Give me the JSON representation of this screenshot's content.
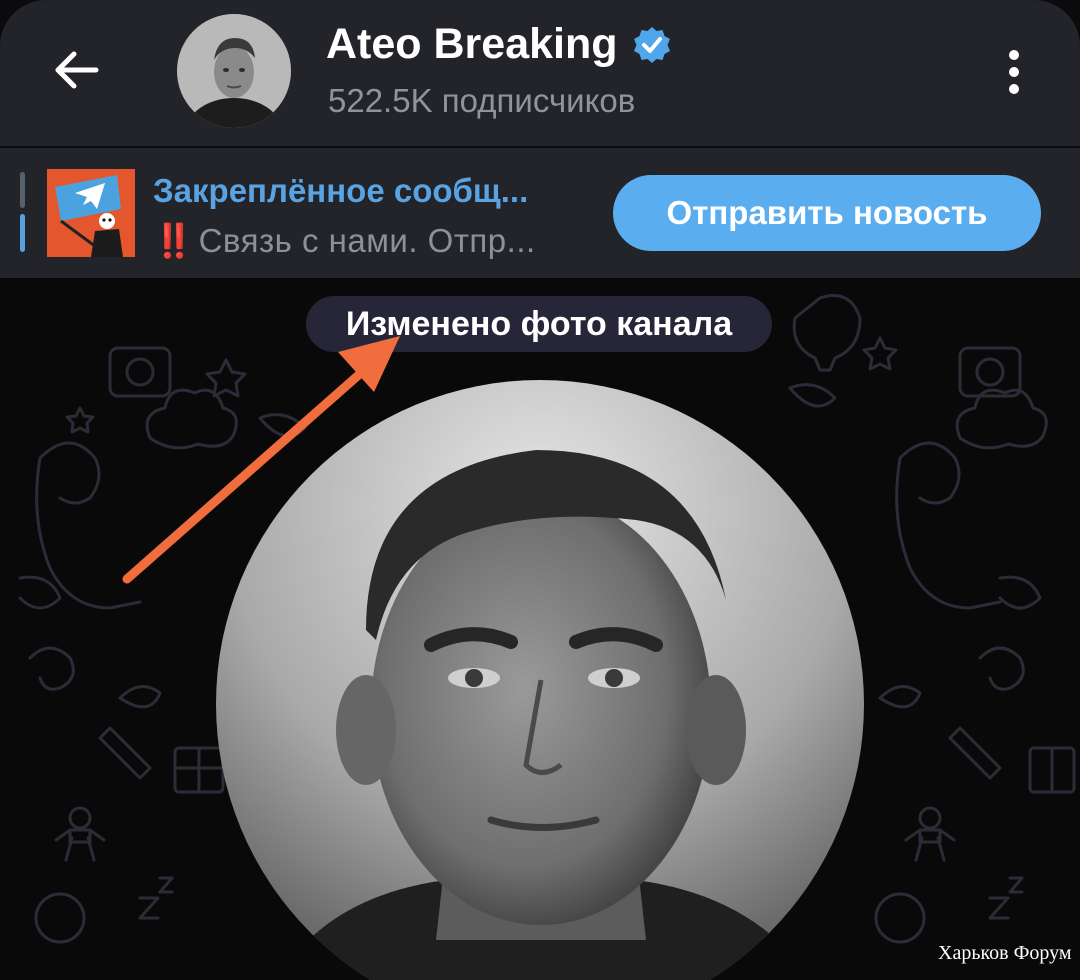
{
  "header": {
    "title": "Ateo Breaking",
    "subscribers": "522.5K подписчиков",
    "back_icon": "arrow-left-icon",
    "verified_icon": "verified-badge-icon",
    "menu_icon": "more-vertical-icon"
  },
  "pinned": {
    "title": "Закреплённое сообщ...",
    "text": "Связь с нами.  Отпр...",
    "text_prefix": "‼️",
    "button_label": "Отправить новость",
    "thumb_icon": "telegram-flag-icon"
  },
  "chat": {
    "service_message": "Изменено фото канала",
    "photo": "channel-photo",
    "annotation": "arrow-pointer"
  },
  "watermark": "Харьков Форум",
  "colors": {
    "header_bg": "#232429",
    "accent_blue": "#5aaef0",
    "link_blue": "#5aa3e2",
    "arrow_orange": "#f26d3d",
    "verified_blue": "#4fa6ea"
  }
}
